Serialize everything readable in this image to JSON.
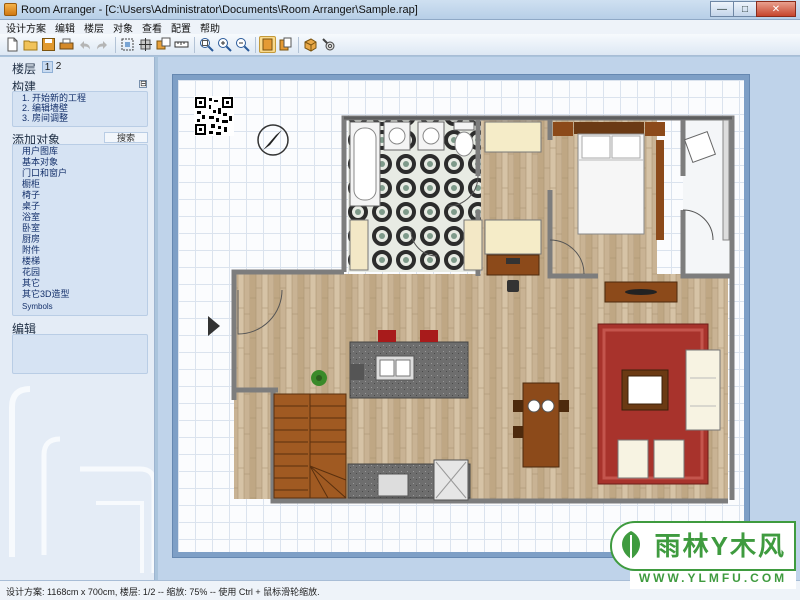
{
  "window": {
    "title": "Room Arranger - [C:\\Users\\Administrator\\Documents\\Room Arranger\\Sample.rap]",
    "minimize": "—",
    "maximize": "□",
    "close": "✕"
  },
  "menu": [
    "设计方案",
    "编辑",
    "楼层",
    "对象",
    "查看",
    "配置",
    "帮助"
  ],
  "toolbar": {
    "icons": [
      "new-file-icon",
      "open-folder-icon",
      "save-icon",
      "print-icon",
      "undo-icon",
      "redo-icon",
      "select-icon",
      "move-icon",
      "duplicate-icon",
      "measure-icon",
      "zoom-fit-icon",
      "zoom-in-icon",
      "zoom-out-icon",
      "view-2d-icon",
      "view-3d-icon",
      "box-3d-icon",
      "settings-3d-icon"
    ]
  },
  "sidebar": {
    "floors_label": "楼层",
    "floors": [
      "1",
      "2"
    ],
    "build_label": "构建",
    "build_collapse": "⊟",
    "build_items": [
      "1. 开始新的工程",
      "2. 编辑墙壁",
      "3. 房间调整"
    ],
    "add_label": "添加对象",
    "search_label": "搜索",
    "categories": [
      "用户图库",
      "基本对象",
      "门口和窗户",
      "橱柜",
      "椅子",
      "桌子",
      "浴室",
      "卧室",
      "厨房",
      "附件",
      "楼梯",
      "花园",
      "其它",
      "其它3D造型",
      "Symbols"
    ],
    "edit_label": "编辑"
  },
  "status": {
    "text": "设计方案: 1168cm x 700cm, 楼层: 1/2 -- 缩放: 75% -- 使用 Ctrl + 鼠标滑轮缩放."
  },
  "watermark": {
    "main": "雨林Y木风",
    "sub": "WWW.YLMFU.COM"
  },
  "colors": {
    "accent": "#3f9b3f",
    "wood": "#c9b394",
    "wall": "#8a8a8a",
    "rug": "#a8332c"
  }
}
